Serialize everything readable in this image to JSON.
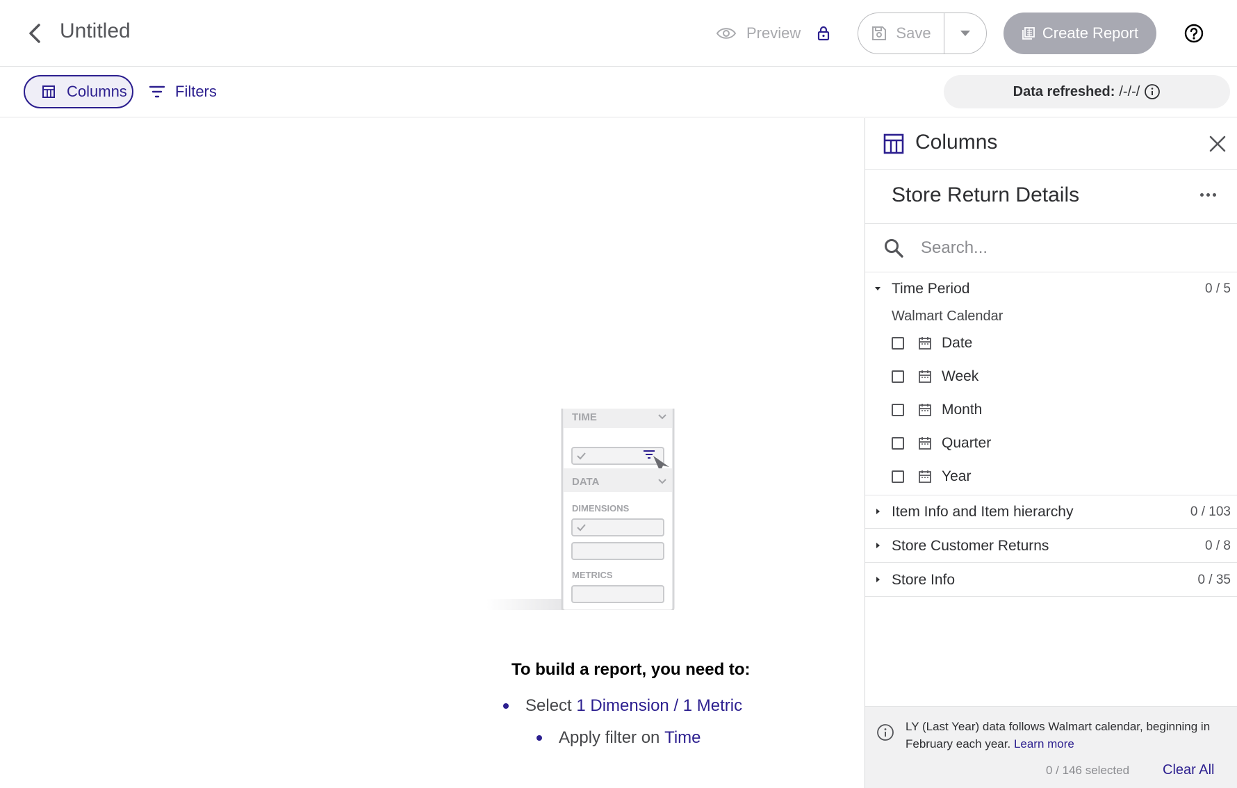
{
  "header": {
    "title": "Untitled",
    "preview_label": "Preview",
    "save_label": "Save",
    "create_report_label": "Create Report"
  },
  "toolbar": {
    "columns_label": "Columns",
    "filters_label": "Filters",
    "data_refreshed_label": "Data refreshed:",
    "data_refreshed_value": "/-/-/"
  },
  "illustration": {
    "time_label": "TIME",
    "data_label": "DATA",
    "dimensions_label": "DIMENSIONS",
    "metrics_label": "METRICS"
  },
  "instructions": {
    "title": "To build a report, you need to:",
    "step1_prefix": "Select",
    "step1_highlight": "1 Dimension / 1 Metric",
    "step2_prefix": "Apply filter on",
    "step2_highlight": "Time"
  },
  "panel": {
    "title": "Columns",
    "source_name": "Store Return Details",
    "search_placeholder": "Search...",
    "groups": [
      {
        "name": "Time Period",
        "count": "0 / 5",
        "expanded": true
      },
      {
        "name": "Item Info and Item hierarchy",
        "count": "0 / 103",
        "expanded": false
      },
      {
        "name": "Store Customer Returns",
        "count": "0 / 8",
        "expanded": false
      },
      {
        "name": "Store Info",
        "count": "0 / 35",
        "expanded": false
      }
    ],
    "time_subheading": "Walmart Calendar",
    "time_items": [
      "Date",
      "Week",
      "Month",
      "Quarter",
      "Year"
    ],
    "footer_note": "LY (Last Year) data follows Walmart calendar, beginning in February each year.",
    "learn_more": "Learn more",
    "selected_count": "0 / 146 selected",
    "clear_all": "Clear All"
  },
  "colors": {
    "accent": "#2c1f8f",
    "disabled_button": "#a8a9b2",
    "muted_text": "#a8a9ad"
  }
}
